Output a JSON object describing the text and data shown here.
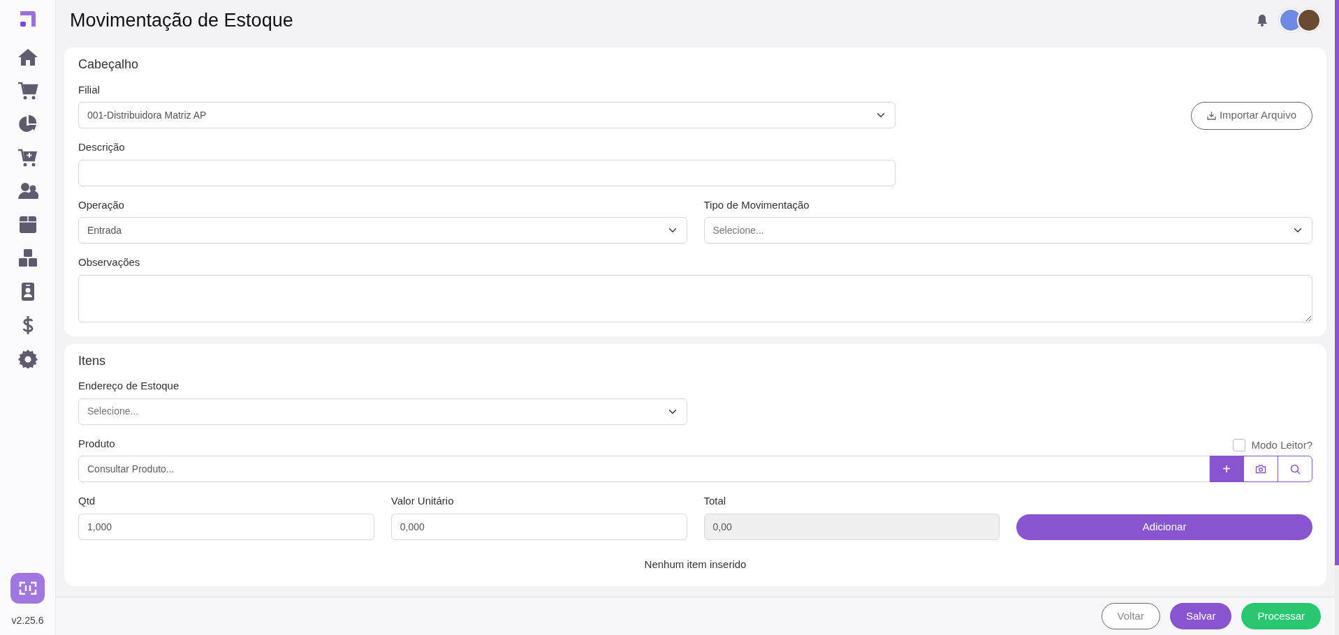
{
  "header": {
    "title": "Movimentação de Estoque"
  },
  "sidebar": {
    "version": "v2.25.6"
  },
  "cabecalho": {
    "title": "Cabeçalho",
    "import_button": "Importar Arquivo",
    "filial": {
      "label": "Filial",
      "value": "001-Distribuidora Matriz AP"
    },
    "descricao": {
      "label": "Descrição"
    },
    "operacao": {
      "label": "Operação",
      "value": "Entrada"
    },
    "tipo": {
      "label": "Tipo de Movimentação",
      "placeholder": "Selecione..."
    },
    "observacoes": {
      "label": "Observações"
    }
  },
  "itens": {
    "title": "Itens",
    "endereco": {
      "label": "Endereço de Estoque",
      "placeholder": "Selecione..."
    },
    "produto": {
      "label": "Produto",
      "placeholder": "Consultar Produto...",
      "add_symbol": "+"
    },
    "modo_leitor": {
      "label": "Modo Leitor?",
      "checked": false
    },
    "qtd": {
      "label": "Qtd",
      "value": "1,000",
      "disabled": false
    },
    "valor_unitario": {
      "label": "Valor Unitário",
      "value": "0,000",
      "disabled": false
    },
    "total": {
      "label": "Total",
      "value": "0,00",
      "disabled": true
    },
    "add_button": "Adicionar",
    "empty_message": "Nenhum item inserido"
  },
  "footer": {
    "buttons": [
      {
        "label": "Voltar",
        "kind": "outline"
      },
      {
        "label": "Salvar",
        "kind": "primary"
      },
      {
        "label": "Processar",
        "kind": "success"
      }
    ]
  }
}
